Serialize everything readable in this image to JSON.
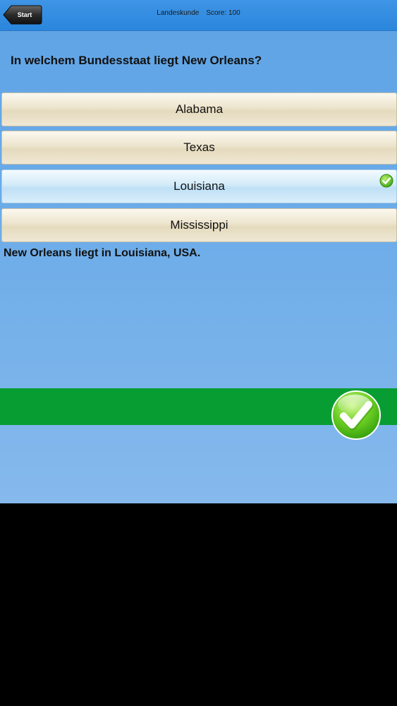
{
  "navbar": {
    "back_label": "Start",
    "category": "Landeskunde",
    "score_label": "Score: 100"
  },
  "question": {
    "text": "In welchem Bundesstaat liegt New Orleans?"
  },
  "answers": [
    {
      "label": "Alabama",
      "selected": false
    },
    {
      "label": "Texas",
      "selected": false
    },
    {
      "label": "Louisiana",
      "selected": true
    },
    {
      "label": "Mississippi",
      "selected": false
    }
  ],
  "explanation": "New Orleans liegt in Louisiana, USA.",
  "result": {
    "state": "correct",
    "bar_color": "#079d33",
    "icon": "checkmark-icon"
  },
  "colors": {
    "navbar": "#2a86dc",
    "background": "#6aabe8",
    "answer_normal": "#ece4cc",
    "answer_selected": "#d3ebf9"
  }
}
